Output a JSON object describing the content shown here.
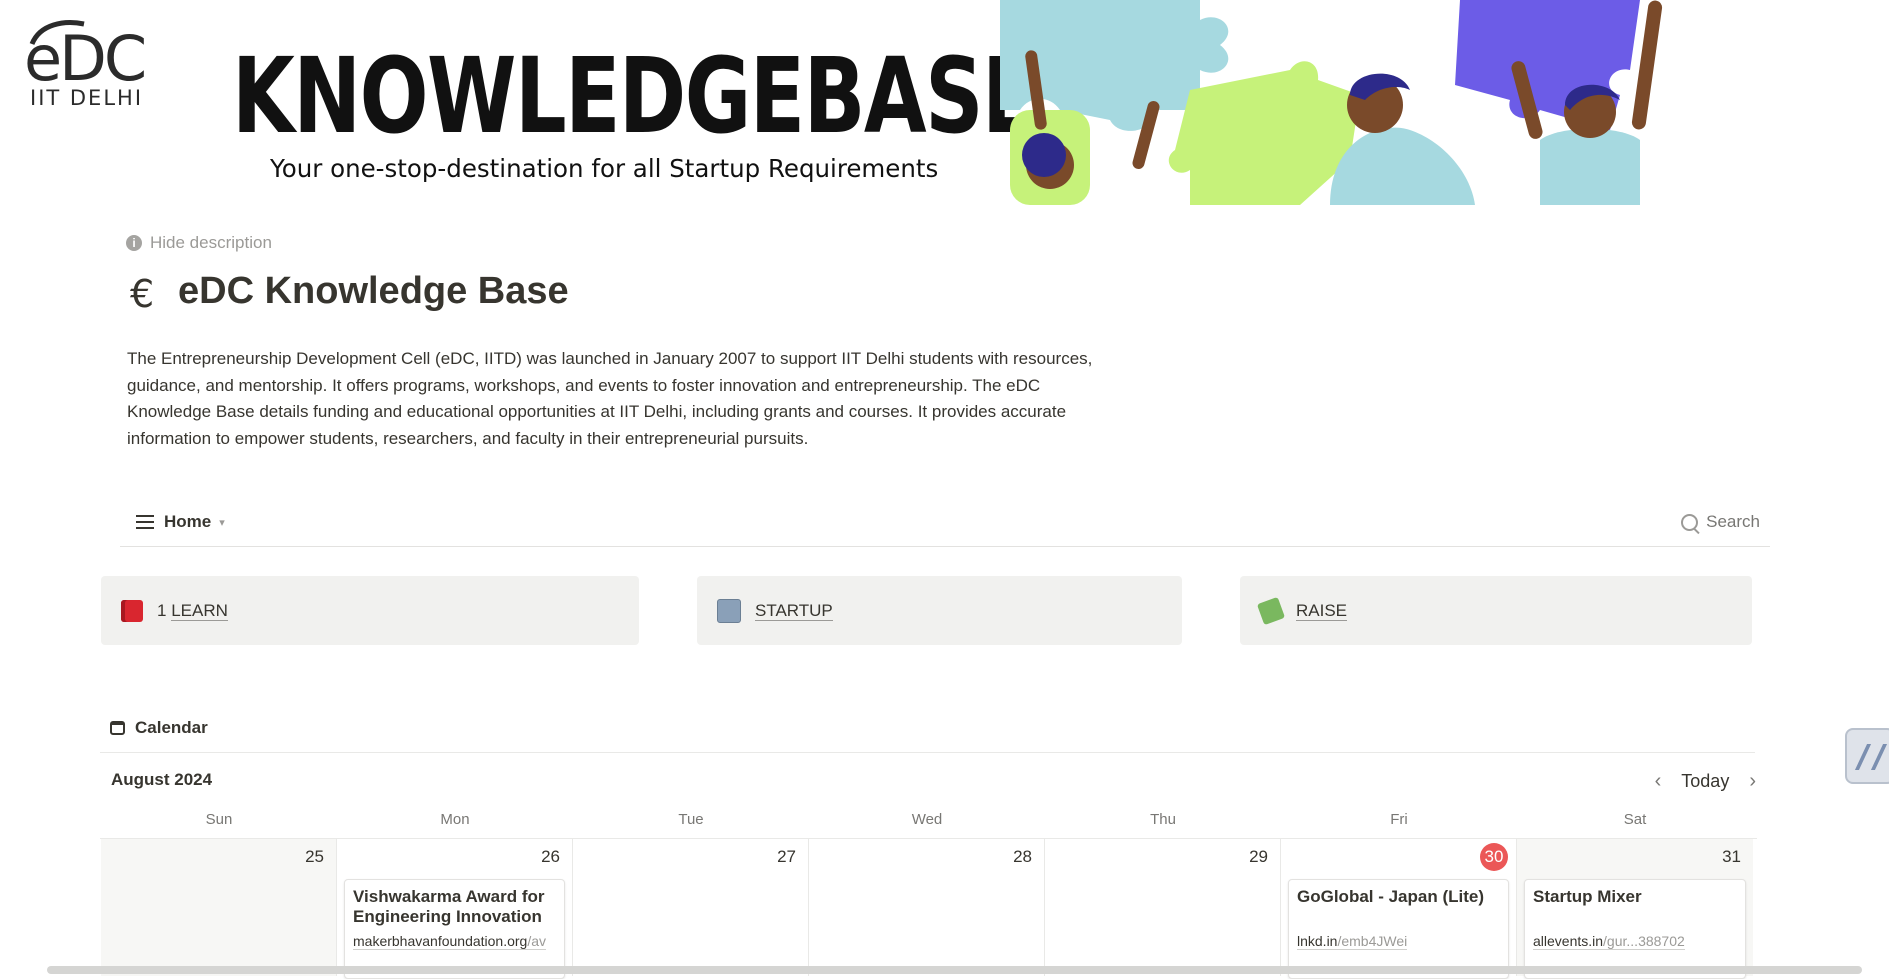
{
  "banner": {
    "logo_main": "eDC",
    "logo_sub": "IIT DELHI",
    "title": "KNOWLEDGEBASE",
    "subtitle": "Your one-stop-destination for all Startup Requirements"
  },
  "header": {
    "hide_description": "Hide description",
    "page_icon": "eDC-logo-icon",
    "title": "eDC Knowledge Base",
    "description": "The Entrepreneurship Development Cell (eDC, IITD) was launched in January 2007 to support IIT Delhi students with resources, guidance, and mentorship. It offers programs, workshops, and events to foster innovation and entrepreneurship. The eDC Knowledge Base details funding and educational opportunities at IIT Delhi, including grants and courses. It provides accurate information to empower students, researchers, and faculty in their entrepreneurial pursuits."
  },
  "view_bar": {
    "view_name": "Home",
    "search_label": "Search"
  },
  "cards": [
    {
      "prefix": "1 ",
      "label": "LEARN",
      "icon": "red-book-icon"
    },
    {
      "prefix": "",
      "label": "STARTUP",
      "icon": "card-file-box-icon"
    },
    {
      "prefix": "",
      "label": "RAISE",
      "icon": "money-with-wings-icon"
    }
  ],
  "calendar": {
    "heading": "Calendar",
    "month": "August 2024",
    "today_label": "Today",
    "weekdays": [
      "Sun",
      "Mon",
      "Tue",
      "Wed",
      "Thu",
      "Fri",
      "Sat"
    ],
    "days": [
      "25",
      "26",
      "27",
      "28",
      "29",
      "30",
      "31"
    ],
    "today_index": 5,
    "events": {
      "mon": {
        "title": "Vishwakarma Award for Engineering Innovation ...",
        "link_domain": "makerbhavanfoundation.org",
        "link_path": "/av"
      },
      "fri": {
        "title": "GoGlobal - Japan (Lite)",
        "link_domain": "lnkd.in",
        "link_path": "/emb4JWei"
      },
      "sat": {
        "title": "Startup Mixer",
        "link_domain": "allevents.in",
        "link_path": "/gur...388702"
      }
    }
  },
  "colors": {
    "today_badge": "#eb5757",
    "card_bg": "#f1f1ef",
    "text": "#37352f"
  }
}
